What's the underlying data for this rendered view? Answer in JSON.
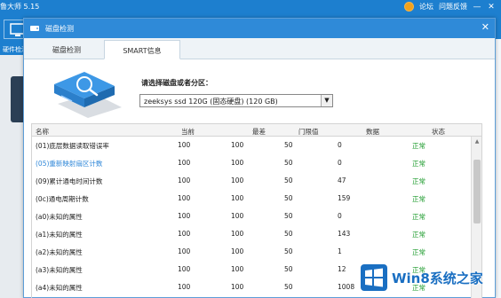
{
  "app": {
    "title": "鲁大师 5.15",
    "forum_label": "论坛",
    "feedback_label": "问题反馈",
    "left_label": "硬件检测",
    "min_glyph": "—",
    "close_glyph": "✕"
  },
  "dialog": {
    "title": "磁盘检测",
    "close_glyph": "✕",
    "tabs": [
      {
        "label": "磁盘检测"
      },
      {
        "label": "SMART信息"
      }
    ],
    "select_label": "请选择磁盘或者分区：",
    "disk_value": "zeeksys ssd 120G (固态硬盘) (120 GB)",
    "dropdown_glyph": "▼"
  },
  "table": {
    "headers": [
      "名称",
      "当前",
      "最差",
      "门限值",
      "数据",
      "状态"
    ],
    "rows": [
      {
        "name": "(01)底层数据读取错误率",
        "cur": "100",
        "worst": "100",
        "thr": "50",
        "raw": "0",
        "status": "正常"
      },
      {
        "name": "(05)重新映射扇区计数",
        "cur": "100",
        "worst": "100",
        "thr": "50",
        "raw": "0",
        "status": "正常"
      },
      {
        "name": "(09)累计通电时间计数",
        "cur": "100",
        "worst": "100",
        "thr": "50",
        "raw": "47",
        "status": "正常"
      },
      {
        "name": "(0c)通电周期计数",
        "cur": "100",
        "worst": "100",
        "thr": "50",
        "raw": "159",
        "status": "正常"
      },
      {
        "name": "(a0)未知的属性",
        "cur": "100",
        "worst": "100",
        "thr": "50",
        "raw": "0",
        "status": "正常"
      },
      {
        "name": "(a1)未知的属性",
        "cur": "100",
        "worst": "100",
        "thr": "50",
        "raw": "143",
        "status": "正常"
      },
      {
        "name": "(a2)未知的属性",
        "cur": "100",
        "worst": "100",
        "thr": "50",
        "raw": "1",
        "status": "正常"
      },
      {
        "name": "(a3)未知的属性",
        "cur": "100",
        "worst": "100",
        "thr": "50",
        "raw": "12",
        "status": "正常"
      },
      {
        "name": "(a4)未知的属性",
        "cur": "100",
        "worst": "100",
        "thr": "50",
        "raw": "1008",
        "status": "正常"
      }
    ],
    "selected_row": 1
  },
  "watermark": {
    "text": "Win8系统之家"
  },
  "colors": {
    "accent": "#2f8ad8",
    "status_ok": "#1a9a2a",
    "selected_text": "#2f87d8"
  }
}
